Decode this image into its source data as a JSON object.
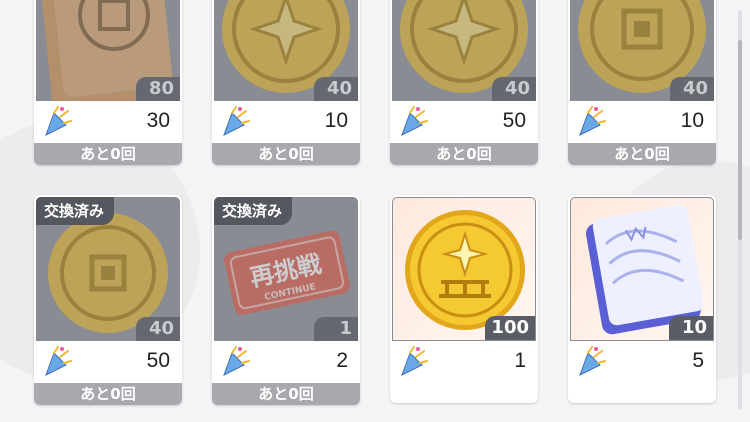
{
  "items": [
    {
      "name": "mirror-book",
      "qty": "80",
      "cost": "30",
      "remaining": "あと0回",
      "exchanged": true,
      "tag": ""
    },
    {
      "name": "medal-star",
      "qty": "40",
      "cost": "10",
      "remaining": "あと0回",
      "exchanged": true,
      "tag": ""
    },
    {
      "name": "medal-star",
      "qty": "40",
      "cost": "50",
      "remaining": "あと0回",
      "exchanged": true,
      "tag": ""
    },
    {
      "name": "medal-mirror",
      "qty": "40",
      "cost": "10",
      "remaining": "あと0回",
      "exchanged": true,
      "tag": ""
    },
    {
      "name": "medal-mirror",
      "qty": "40",
      "cost": "50",
      "remaining": "あと0回",
      "exchanged": true,
      "tag": "交換済み"
    },
    {
      "name": "retry-ticket",
      "qty": "1",
      "cost": "2",
      "remaining": "あと0回",
      "exchanged": true,
      "tag": "交換済み",
      "ticket_text": "再挑戦",
      "ticket_sub": "CONTINUE"
    },
    {
      "name": "gold-coin",
      "qty": "100",
      "cost": "1",
      "remaining": "",
      "exchanged": false,
      "tag": ""
    },
    {
      "name": "blue-book",
      "qty": "10",
      "cost": "5",
      "remaining": "",
      "exchanged": false,
      "tag": ""
    }
  ],
  "cost_icon": "party-popper-icon",
  "colors": {
    "gold": "#e8b820",
    "exchanged_overlay": "#9a9ca4",
    "badge": "#55575f"
  }
}
